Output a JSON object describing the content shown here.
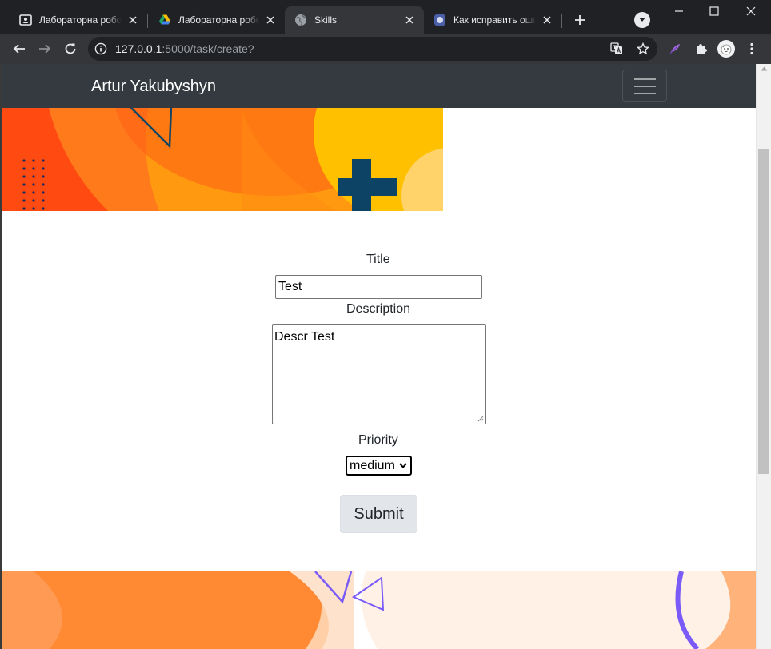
{
  "browser": {
    "tabs": [
      {
        "title": "Лабораторна робота",
        "icon": "classroom-icon",
        "active": false
      },
      {
        "title": "Лабораторна робота",
        "icon": "google-drive-icon",
        "active": false
      },
      {
        "title": "Skills",
        "icon": "globe-icon",
        "active": true
      },
      {
        "title": "Как исправить ошибку",
        "icon": "site-icon",
        "active": false
      }
    ],
    "address": {
      "host": "127.0.0.1",
      "path": ":5000/task/create?"
    }
  },
  "navbar": {
    "brand": "Artur Yakubyshyn"
  },
  "form": {
    "title_label": "Title",
    "title_value": "Test",
    "description_label": "Description",
    "description_value": "Descr Test",
    "priority_label": "Priority",
    "priority_selected": "medium",
    "submit_label": "Submit"
  },
  "colors": {
    "navbar_bg": "#343a40",
    "button_bg": "#e2e6ea",
    "hero_orange": "#ff5a1f",
    "hero_yellow": "#ffb400",
    "hero_navy": "#0d4466",
    "footer_purple": "#7a5af8"
  }
}
